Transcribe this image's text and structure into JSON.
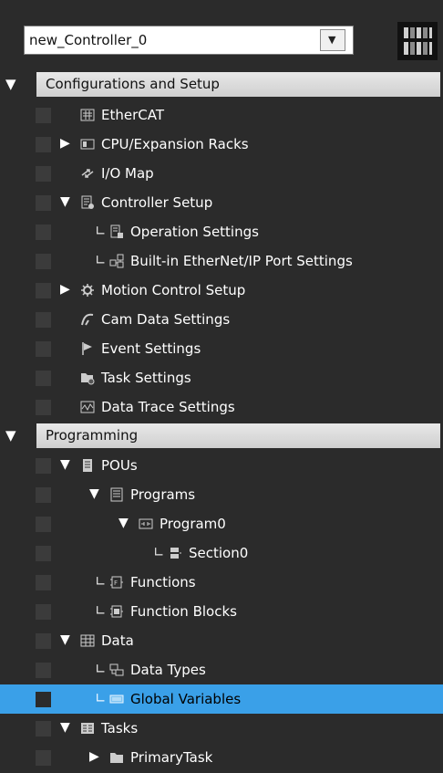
{
  "controller": {
    "selected": "new_Controller_0"
  },
  "sections": {
    "config": "Configurations and Setup",
    "programming": "Programming"
  },
  "config_items": {
    "ethercat": "EtherCAT",
    "cpu_racks": "CPU/Expansion Racks",
    "io_map": "I/O Map",
    "controller_setup": "Controller Setup",
    "operation_settings": "Operation Settings",
    "ethernet_ip": "Built-in EtherNet/IP Port Settings",
    "motion_control": "Motion Control Setup",
    "cam_data": "Cam Data Settings",
    "event_settings": "Event Settings",
    "task_settings": "Task Settings",
    "data_trace": "Data Trace Settings"
  },
  "programming_items": {
    "pous": "POUs",
    "programs": "Programs",
    "program0": "Program0",
    "section0": "Section0",
    "functions": "Functions",
    "function_blocks": "Function Blocks",
    "data": "Data",
    "data_types": "Data Types",
    "global_variables": "Global Variables",
    "tasks": "Tasks",
    "primary_task": "PrimaryTask"
  },
  "colors": {
    "panel_bg": "#2b2b2b",
    "selection": "#3aa0e8",
    "header_bar": "#dcdcdc"
  }
}
